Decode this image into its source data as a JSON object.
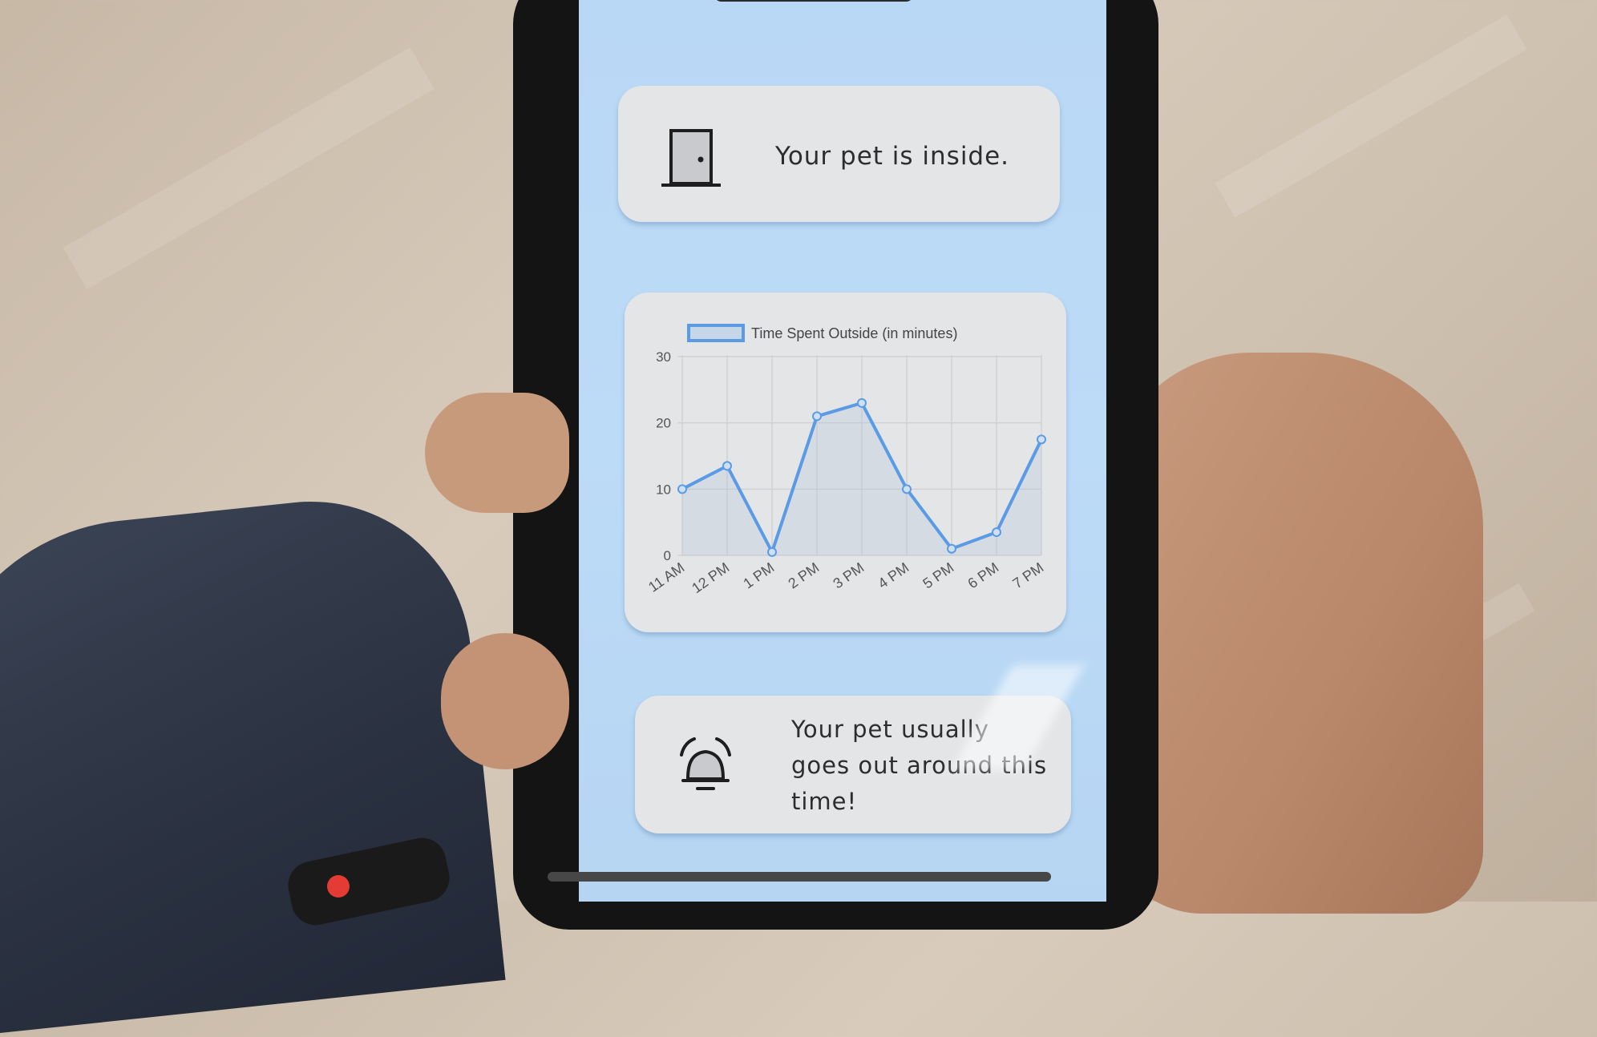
{
  "status": {
    "text": "Your pet is inside.",
    "icon": "door-icon"
  },
  "chart_data": {
    "type": "line",
    "legend": "Time Spent Outside (in minutes)",
    "categories": [
      "11 AM",
      "12 PM",
      "1 PM",
      "2 PM",
      "3 PM",
      "4 PM",
      "5 PM",
      "6 PM",
      "7 PM"
    ],
    "series": [
      {
        "name": "Time Spent Outside (in minutes)",
        "values": [
          10,
          13.5,
          0.5,
          21,
          23,
          10,
          1,
          3.5,
          17.5
        ]
      }
    ],
    "yticks": [
      0,
      10,
      20,
      30
    ],
    "ylim": [
      0,
      30
    ],
    "grid": true,
    "legend_position": "top",
    "color": "#5b9be6"
  },
  "alert": {
    "text": "Your pet usually goes out around this time!",
    "icon": "bell-icon"
  }
}
